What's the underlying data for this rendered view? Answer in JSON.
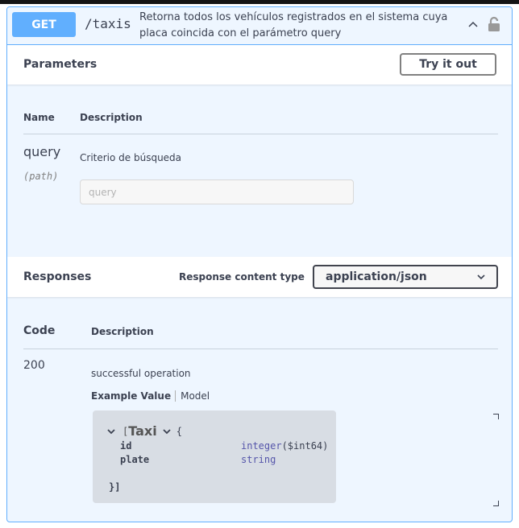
{
  "operation": {
    "method": "GET",
    "path": "/taxis",
    "summary": "Retorna todos los vehículos registrados en el sistema cuya placa coincida con el parámetro query",
    "icons": [
      "chevron-up-icon",
      "lock-icon"
    ],
    "colors": {
      "method": "#61affe",
      "background": "#eef6ff",
      "border": "#61affe"
    }
  },
  "parameters": {
    "title": "Parameters",
    "try_it_out_label": "Try it out",
    "columns": [
      "Name",
      "Description"
    ],
    "items": [
      {
        "name": "query",
        "in": "(path)",
        "description": "Criterio de búsqueda",
        "placeholder": "query",
        "value": ""
      }
    ]
  },
  "responses": {
    "title": "Responses",
    "content_type_label": "Response content type",
    "content_type_selected": "application/json",
    "columns": [
      "Code",
      "Description"
    ],
    "items": [
      {
        "code": "200",
        "description": "successful operation",
        "tabs": [
          "Example Value",
          "Model"
        ],
        "active_tab": "Example Value",
        "model": {
          "open": "[",
          "name": "Taxi",
          "brace_open": "{",
          "properties": [
            {
              "name": "id",
              "type": "integer",
              "format": "($int64)"
            },
            {
              "name": "plate",
              "type": "string",
              "format": ""
            }
          ],
          "close": "}]"
        }
      }
    ]
  }
}
